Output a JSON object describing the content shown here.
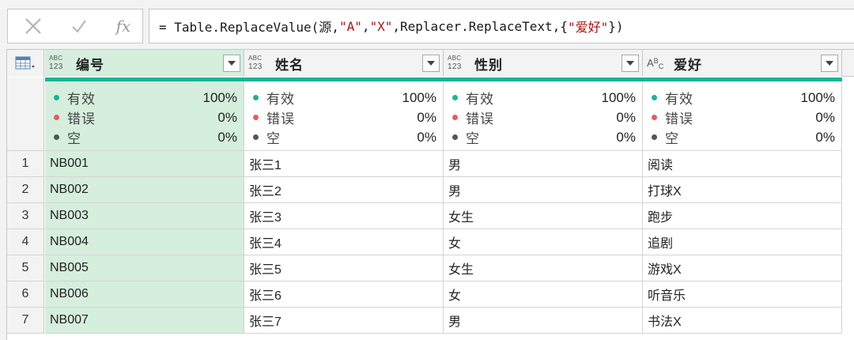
{
  "formula_bar": {
    "cancel_icon": "x-icon",
    "confirm_icon": "check-icon",
    "fx_label": "fx",
    "formula_prefix": "= Table.ReplaceValue(源,",
    "formula_arg1": "\"A\"",
    "formula_sep1": ",",
    "formula_arg2": "\"X\"",
    "formula_mid": ",Replacer.ReplaceText,{",
    "formula_arg3": "\"爱好\"",
    "formula_suffix": "})"
  },
  "colors": {
    "valid": "#19b496",
    "error": "#e35d5d",
    "empty": "#555555",
    "selected_column": "#d5eedd"
  },
  "columns": [
    {
      "name": "编号",
      "type_top": "ABC",
      "type_bottom": "123"
    },
    {
      "name": "姓名",
      "type_top": "ABC",
      "type_bottom": "123"
    },
    {
      "name": "性别",
      "type_top": "ABC",
      "type_bottom": "123"
    },
    {
      "name": "爱好",
      "type_a": "A",
      "type_b": "B",
      "type_c": "C"
    }
  ],
  "profile": {
    "valid_label": "有效",
    "error_label": "错误",
    "empty_label": "空",
    "columns": [
      {
        "valid": "100%",
        "error": "0%",
        "empty": "0%"
      },
      {
        "valid": "100%",
        "error": "0%",
        "empty": "0%"
      },
      {
        "valid": "100%",
        "error": "0%",
        "empty": "0%"
      },
      {
        "valid": "100%",
        "error": "0%",
        "empty": "0%"
      }
    ]
  },
  "rows": [
    {
      "num": "1",
      "cells": [
        "NB001",
        "张三1",
        "男",
        "阅读"
      ]
    },
    {
      "num": "2",
      "cells": [
        "NB002",
        "张三2",
        "男",
        "打球X"
      ]
    },
    {
      "num": "3",
      "cells": [
        "NB003",
        "张三3",
        "女生",
        "跑步"
      ]
    },
    {
      "num": "4",
      "cells": [
        "NB004",
        "张三4",
        "女",
        "追剧"
      ]
    },
    {
      "num": "5",
      "cells": [
        "NB005",
        "张三5",
        "女生",
        "游戏X"
      ]
    },
    {
      "num": "6",
      "cells": [
        "NB006",
        "张三6",
        "女",
        "听音乐"
      ]
    },
    {
      "num": "7",
      "cells": [
        "NB007",
        "张三7",
        "男",
        "书法X"
      ]
    }
  ]
}
